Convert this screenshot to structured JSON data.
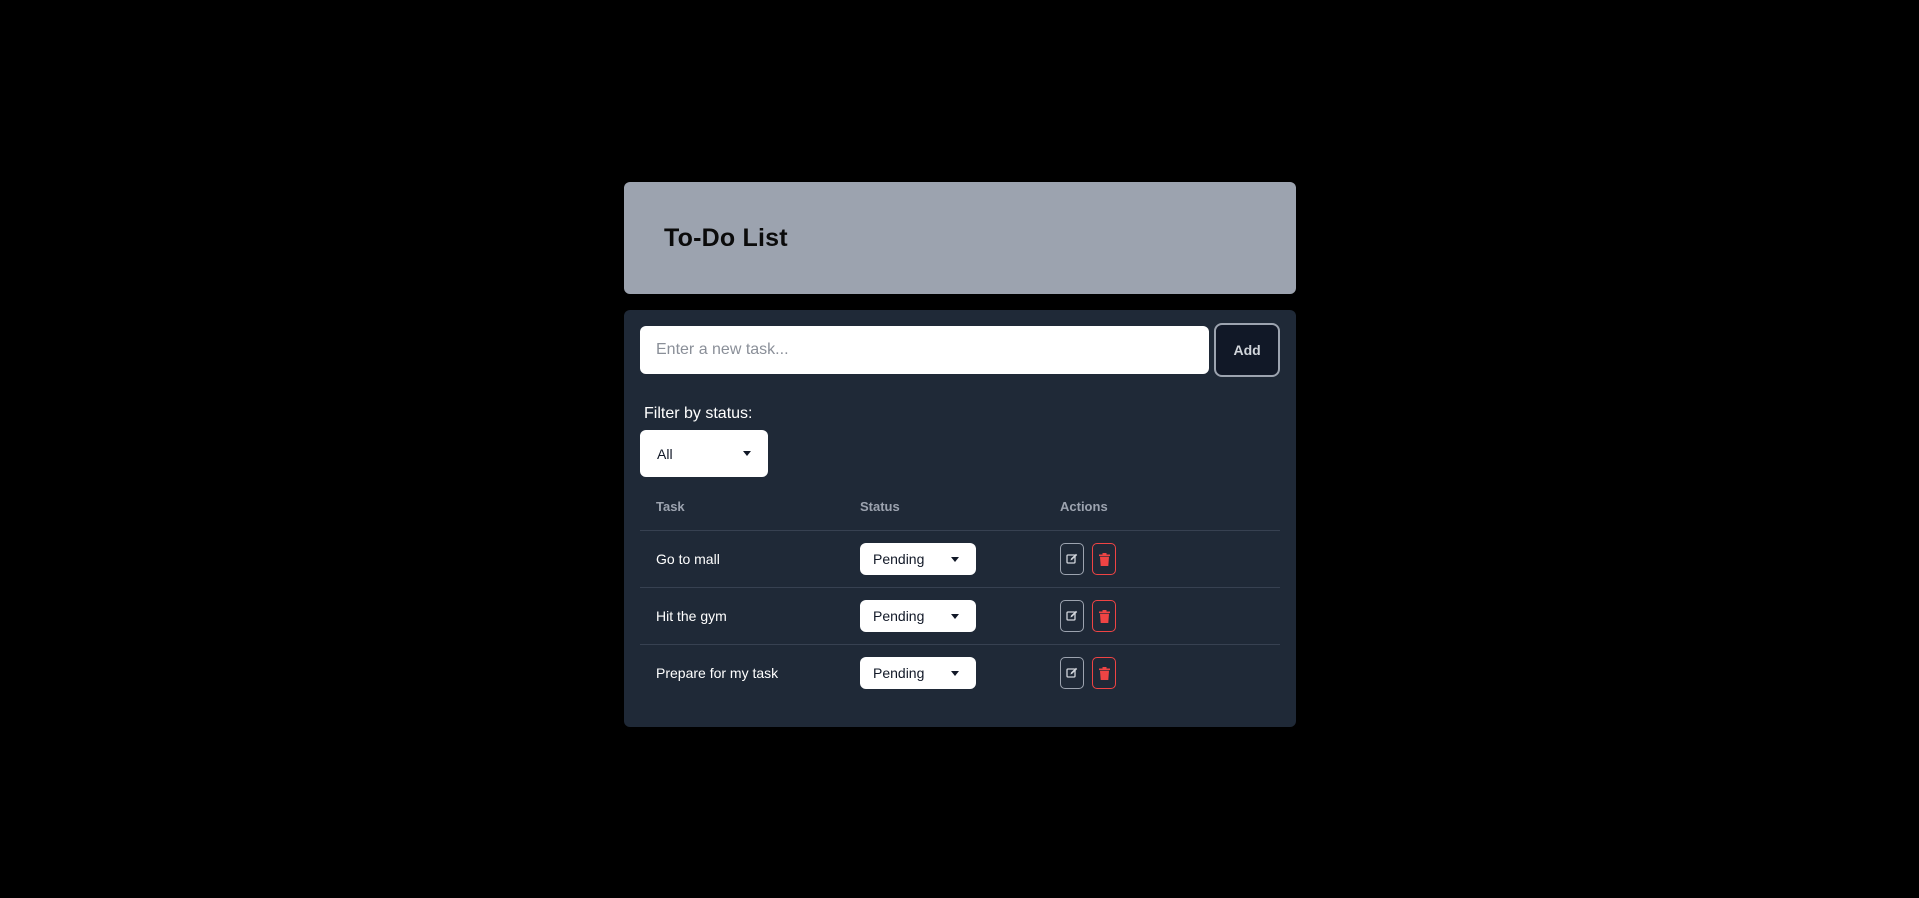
{
  "header": {
    "title": "To-Do List"
  },
  "new_task": {
    "placeholder": "Enter a new task...",
    "value": "",
    "add_label": "Add"
  },
  "filter": {
    "label": "Filter by status:",
    "selected": "All"
  },
  "table": {
    "headers": {
      "task": "Task",
      "status": "Status",
      "actions": "Actions"
    },
    "rows": [
      {
        "task": "Go to mall",
        "status": "Pending"
      },
      {
        "task": "Hit the gym",
        "status": "Pending"
      },
      {
        "task": "Prepare for my task",
        "status": "Pending"
      }
    ]
  },
  "icons": {
    "edit": "edit-icon",
    "delete": "trash-icon"
  },
  "colors": {
    "page_bg": "#000000",
    "header_bg": "#9ca3af",
    "panel_bg": "#1f2937",
    "delete_accent": "#ef4444"
  }
}
